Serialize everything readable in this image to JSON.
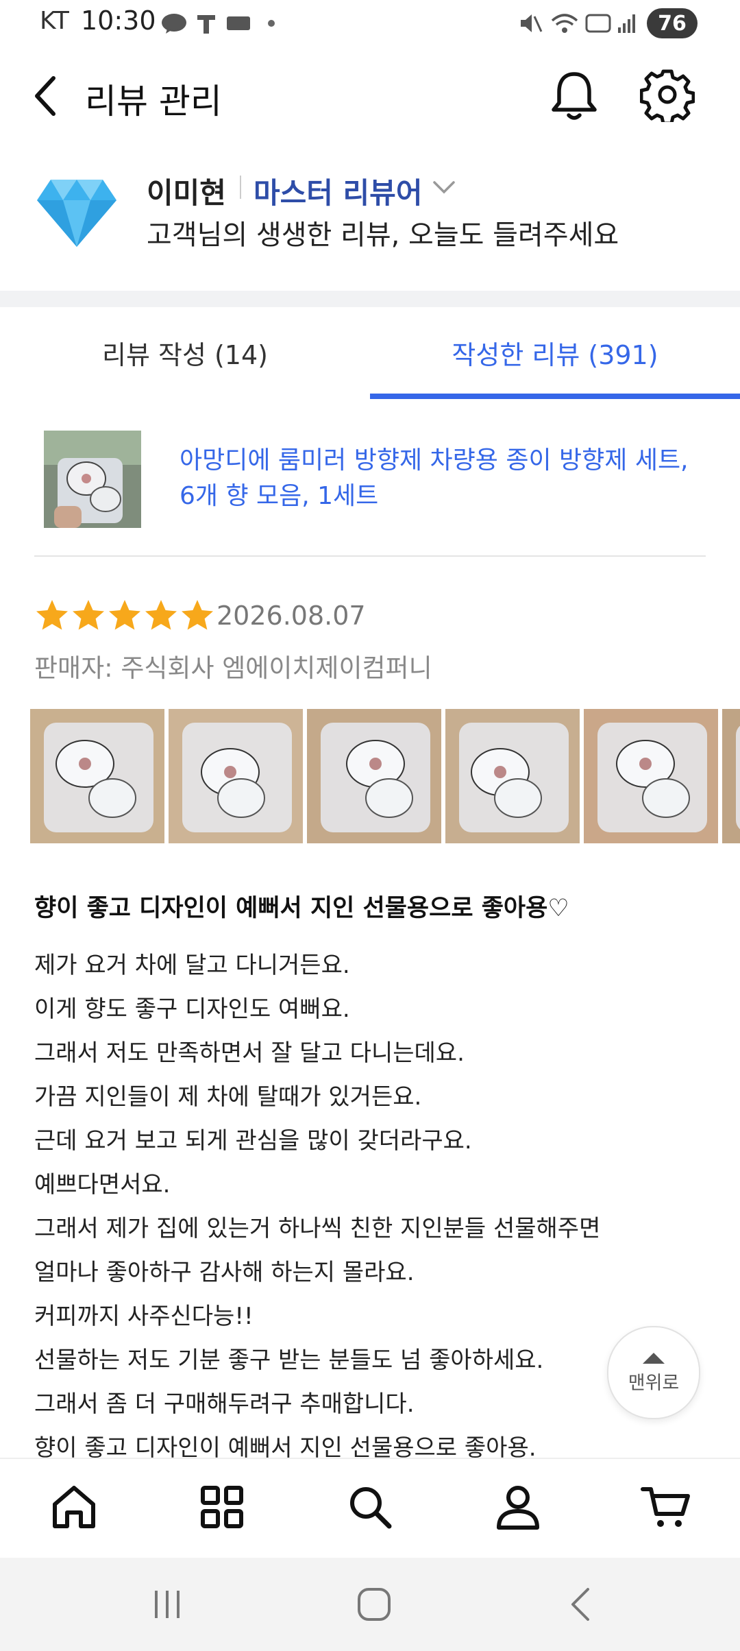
{
  "status_bar": {
    "carrier": "KT",
    "time": "10:30",
    "battery": "76"
  },
  "header": {
    "title": "리뷰 관리",
    "icons": [
      "back-icon",
      "bell-icon",
      "gear-icon"
    ]
  },
  "profile": {
    "name": "이미현",
    "grade": "마스터 리뷰어",
    "message": "고객님의 생생한 리뷰, 오늘도 들려주세요"
  },
  "tabs": [
    {
      "label": "리뷰 작성 (14)",
      "active": false
    },
    {
      "label": "작성한 리뷰 (391)",
      "active": true
    }
  ],
  "review": {
    "product_name": "아망디에 룸미러 방향제 차량용 종이 방향제 세트, 6개 향 모음, 1세트",
    "rating": 5,
    "date": "2026.08.07",
    "seller": "판매자: 주식회사 엠에이치제이컴퍼니",
    "title": "향이 좋고 디자인이 예뻐서 지인 선물용으로 좋아용♡",
    "body_lines": [
      "제가 요거 차에 달고 다니거든요.",
      "이게 향도 좋구 디자인도 여뻐요.",
      "그래서 저도 만족하면서 잘 달고 다니는데요.",
      "가끔 지인들이 제 차에 탈때가 있거든요.",
      "근데 요거 보고 되게 관심을 많이 갖더라구요.",
      "예쁘다면서요.",
      "그래서 제가 집에 있는거 하나씩 친한 지인분들 선물해주면",
      "얼마나 좋아하구 감사해 하는지 몰라요.",
      "커피까지 사주신다능!!",
      "선물하는 저도 기분 좋구 받는 분들도 넘 좋아하세요.",
      "그래서 좀 더 구매해두려구 추매합니다.",
      "향이 좋고 디자인이 예뻐서 지인 선물용으로 좋아용."
    ]
  },
  "scroll_top": {
    "label": "맨위로"
  },
  "bottom_nav": [
    "home-icon",
    "categories-icon",
    "search-icon",
    "my-account-icon",
    "cart-icon"
  ],
  "colors": {
    "accent": "#3567e8",
    "grade": "#2e4da8",
    "star": "#f7a81b"
  }
}
